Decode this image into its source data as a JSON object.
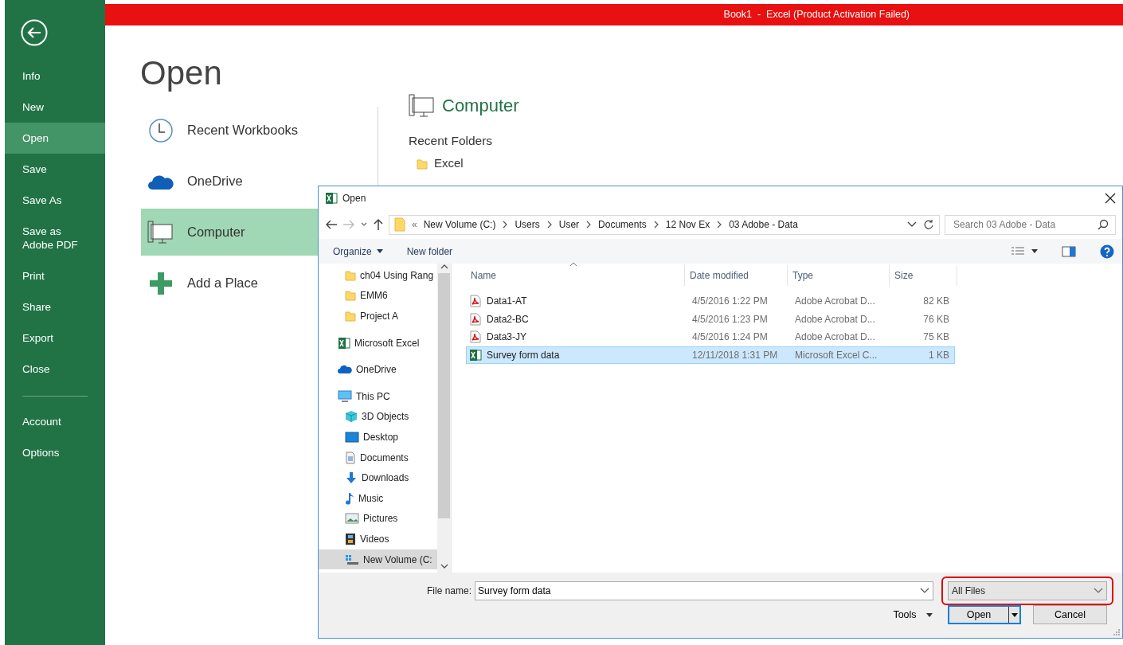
{
  "title_bar": {
    "text": "Book1  -  Excel (Product Activation Failed)"
  },
  "backstage_menu": {
    "primary": [
      {
        "label": "Info",
        "selected": false
      },
      {
        "label": "New",
        "selected": false
      },
      {
        "label": "Open",
        "selected": true
      },
      {
        "label": "Save",
        "selected": false
      },
      {
        "label": "Save As",
        "selected": false
      },
      {
        "label": "Save as Adobe PDF",
        "selected": false
      },
      {
        "label": "Print",
        "selected": false
      },
      {
        "label": "Share",
        "selected": false
      },
      {
        "label": "Export",
        "selected": false
      },
      {
        "label": "Close",
        "selected": false
      }
    ],
    "secondary": [
      {
        "label": "Account",
        "selected": false
      },
      {
        "label": "Options",
        "selected": false
      }
    ]
  },
  "page_title": "Open",
  "locations": [
    {
      "label": "Recent Workbooks",
      "kind": "recent",
      "selected": false
    },
    {
      "label": "OneDrive",
      "kind": "cloud",
      "selected": false
    },
    {
      "label": "Computer",
      "kind": "computer",
      "selected": true
    },
    {
      "label": "Add a Place",
      "kind": "add",
      "selected": false
    }
  ],
  "location_panel": {
    "title": "Computer",
    "subtitle": "Recent Folders",
    "folders": [
      "Excel"
    ]
  },
  "dialog": {
    "title": "Open",
    "breadcrumb_overflow": "«",
    "breadcrumb": [
      "New Volume (C:)",
      "Users",
      "User",
      "Documents",
      "12 Nov Ex",
      "03 Adobe - Data"
    ],
    "search": {
      "placeholder": "Search 03 Adobe - Data"
    },
    "toolbar": [
      "Organize",
      "New folder"
    ],
    "nav_pane": {
      "continued_children": [
        {
          "label": "ch04 Using Rang",
          "kind": "folder",
          "selected": false
        },
        {
          "label": "EMM6",
          "kind": "folder",
          "selected": false
        },
        {
          "label": "Project A",
          "kind": "folder",
          "selected": false
        }
      ],
      "items": [
        {
          "label": "Microsoft Excel",
          "kind": "excel",
          "selected": false
        },
        {
          "label": "OneDrive",
          "kind": "cloud",
          "selected": false
        },
        {
          "label": "This PC",
          "kind": "pc",
          "selected": false,
          "children": [
            {
              "label": "3D Objects",
              "kind": "cube",
              "selected": false
            },
            {
              "label": "Desktop",
              "kind": "desktop",
              "selected": false
            },
            {
              "label": "Documents",
              "kind": "documents",
              "selected": false
            },
            {
              "label": "Downloads",
              "kind": "downloads",
              "selected": false
            },
            {
              "label": "Music",
              "kind": "music",
              "selected": false
            },
            {
              "label": "Pictures",
              "kind": "pictures",
              "selected": false
            },
            {
              "label": "Videos",
              "kind": "videos",
              "selected": false
            },
            {
              "label": "New Volume (C:",
              "kind": "drive",
              "selected": true
            }
          ]
        }
      ]
    },
    "columns": [
      "Name",
      "Date modified",
      "Type",
      "Size"
    ],
    "files": [
      {
        "name": "Data1-AT",
        "kind": "pdf",
        "date": "4/5/2016 1:22 PM",
        "type": "Adobe Acrobat D...",
        "size": "82 KB",
        "selected": false
      },
      {
        "name": "Data2-BC",
        "kind": "pdf",
        "date": "4/5/2016 1:23 PM",
        "type": "Adobe Acrobat D...",
        "size": "76 KB",
        "selected": false
      },
      {
        "name": "Data3-JY",
        "kind": "pdf",
        "date": "4/5/2016 1:24 PM",
        "type": "Adobe Acrobat D...",
        "size": "75 KB",
        "selected": false
      },
      {
        "name": "Survey form data",
        "kind": "excel",
        "date": "12/11/2018 1:31 PM",
        "type": "Microsoft Excel C...",
        "size": "1 KB",
        "selected": true
      }
    ],
    "file_name_label": "File name:",
    "file_name": "Survey form data",
    "file_type": {
      "value": "All Files",
      "highlighted": true
    },
    "tools": "Tools",
    "open_button": "Open",
    "cancel_button": "Cancel"
  }
}
